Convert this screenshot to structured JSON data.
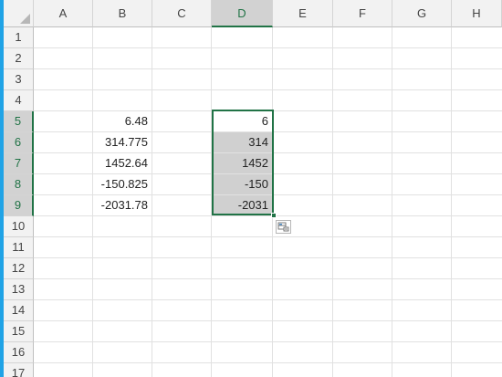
{
  "columns": [
    "A",
    "B",
    "C",
    "D",
    "E",
    "F",
    "G",
    "H"
  ],
  "rows": [
    "1",
    "2",
    "3",
    "4",
    "5",
    "6",
    "7",
    "8",
    "9",
    "10",
    "11",
    "12",
    "13",
    "14",
    "15",
    "16",
    "17"
  ],
  "column_b": [
    "6.48",
    "314.775",
    "1452.64",
    "-150.825",
    "-2031.78"
  ],
  "column_d": [
    "6",
    "314",
    "1452",
    "-150",
    "-2031"
  ],
  "colors": {
    "selection_accent": "#217346",
    "highlight_fill": "#d0d0d0",
    "header_fill": "#f2f2f2",
    "left_strip": "#20a3e6"
  },
  "icons": {
    "quick_analysis": "quick-analysis-icon"
  }
}
